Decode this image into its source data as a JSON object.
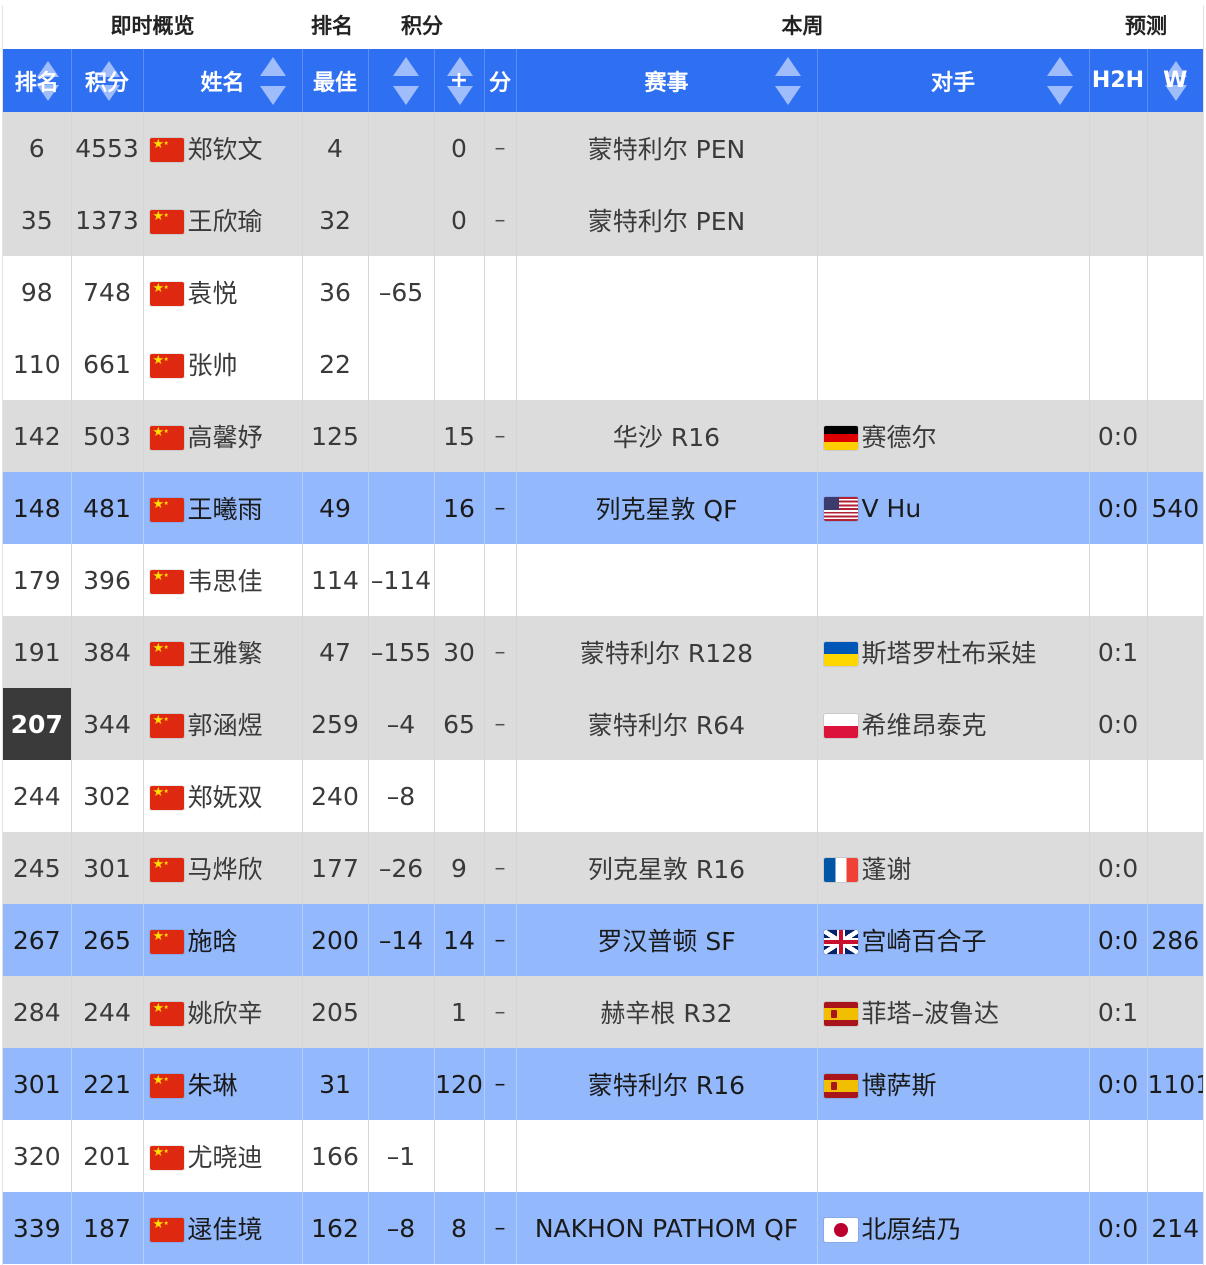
{
  "group_headers": {
    "live_overview": "即时概览",
    "rank": "排名",
    "points": "积分",
    "this_week": "本周",
    "prediction": "预测"
  },
  "columns": {
    "rank": "排名",
    "points": "积分",
    "name": "姓名",
    "best": "最佳",
    "change": "",
    "plus": "+",
    "points_suffix": "分",
    "event": "赛事",
    "opponent": "对手",
    "h2h": "H2H",
    "w": "W"
  },
  "rows": [
    {
      "rank": "6",
      "points": "4553",
      "flag": "cn",
      "name": "郑钦文",
      "best": "4",
      "change": "",
      "plus": "0",
      "dash": "–",
      "event": "蒙特利尔 PEN",
      "opp_flag": "",
      "opponent": "",
      "h2h": "",
      "w": "",
      "bg": "gray",
      "rank_highlight": false
    },
    {
      "rank": "35",
      "points": "1373",
      "flag": "cn",
      "name": "王欣瑜",
      "best": "32",
      "change": "",
      "plus": "0",
      "dash": "–",
      "event": "蒙特利尔 PEN",
      "opp_flag": "",
      "opponent": "",
      "h2h": "",
      "w": "",
      "bg": "gray",
      "rank_highlight": false
    },
    {
      "rank": "98",
      "points": "748",
      "flag": "cn",
      "name": "袁悦",
      "best": "36",
      "change": "–65",
      "plus": "",
      "dash": "",
      "event": "",
      "opp_flag": "",
      "opponent": "",
      "h2h": "",
      "w": "",
      "bg": "white",
      "rank_highlight": false
    },
    {
      "rank": "110",
      "points": "661",
      "flag": "cn",
      "name": "张帅",
      "best": "22",
      "change": "",
      "plus": "",
      "dash": "",
      "event": "",
      "opp_flag": "",
      "opponent": "",
      "h2h": "",
      "w": "",
      "bg": "white",
      "rank_highlight": false
    },
    {
      "rank": "142",
      "points": "503",
      "flag": "cn",
      "name": "高馨妤",
      "best": "125",
      "change": "",
      "plus": "15",
      "dash": "–",
      "event": "华沙 R16",
      "opp_flag": "de",
      "opponent": "赛德尔",
      "h2h": "0:0",
      "w": "",
      "bg": "gray",
      "rank_highlight": false
    },
    {
      "rank": "148",
      "points": "481",
      "flag": "cn",
      "name": "王曦雨",
      "best": "49",
      "change": "",
      "plus": "16",
      "dash": "–",
      "event": "列克星敦 QF",
      "opp_flag": "us",
      "opponent": "V Hu",
      "h2h": "0:0",
      "w": "540",
      "bg": "blue",
      "rank_highlight": false
    },
    {
      "rank": "179",
      "points": "396",
      "flag": "cn",
      "name": "韦思佳",
      "best": "114",
      "change": "–114",
      "plus": "",
      "dash": "",
      "event": "",
      "opp_flag": "",
      "opponent": "",
      "h2h": "",
      "w": "",
      "bg": "white",
      "rank_highlight": false
    },
    {
      "rank": "191",
      "points": "384",
      "flag": "cn",
      "name": "王雅繁",
      "best": "47",
      "change": "–155",
      "plus": "30",
      "dash": "–",
      "event": "蒙特利尔 R128",
      "opp_flag": "ua",
      "opponent": "斯塔罗杜布采娃",
      "h2h": "0:1",
      "w": "",
      "bg": "gray",
      "rank_highlight": false
    },
    {
      "rank": "207",
      "points": "344",
      "flag": "cn",
      "name": "郭涵煜",
      "best": "259",
      "change": "–4",
      "plus": "65",
      "dash": "–",
      "event": "蒙特利尔 R64",
      "opp_flag": "pl",
      "opponent": "希维昂泰克",
      "h2h": "0:0",
      "w": "",
      "bg": "gray",
      "rank_highlight": true
    },
    {
      "rank": "244",
      "points": "302",
      "flag": "cn",
      "name": "郑妩双",
      "best": "240",
      "change": "–8",
      "plus": "",
      "dash": "",
      "event": "",
      "opp_flag": "",
      "opponent": "",
      "h2h": "",
      "w": "",
      "bg": "white",
      "rank_highlight": false
    },
    {
      "rank": "245",
      "points": "301",
      "flag": "cn",
      "name": "马烨欣",
      "best": "177",
      "change": "–26",
      "plus": "9",
      "dash": "–",
      "event": "列克星敦 R16",
      "opp_flag": "fr",
      "opponent": "蓬谢",
      "h2h": "0:0",
      "w": "",
      "bg": "gray",
      "rank_highlight": false
    },
    {
      "rank": "267",
      "points": "265",
      "flag": "cn",
      "name": "施晗",
      "best": "200",
      "change": "–14",
      "plus": "14",
      "dash": "–",
      "event": "罗汉普顿 SF",
      "opp_flag": "gb",
      "opponent": "宫崎百合子",
      "h2h": "0:0",
      "w": "286",
      "bg": "blue",
      "rank_highlight": false
    },
    {
      "rank": "284",
      "points": "244",
      "flag": "cn",
      "name": "姚欣辛",
      "best": "205",
      "change": "",
      "plus": "1",
      "dash": "–",
      "event": "赫辛根 R32",
      "opp_flag": "es",
      "opponent": "菲塔–波鲁达",
      "h2h": "0:1",
      "w": "",
      "bg": "gray",
      "rank_highlight": false
    },
    {
      "rank": "301",
      "points": "221",
      "flag": "cn",
      "name": "朱琳",
      "best": "31",
      "change": "",
      "plus": "120",
      "dash": "–",
      "event": "蒙特利尔 R16",
      "opp_flag": "es",
      "opponent": "博萨斯",
      "h2h": "0:0",
      "w": "1101",
      "bg": "blue",
      "rank_highlight": false
    },
    {
      "rank": "320",
      "points": "201",
      "flag": "cn",
      "name": "尤晓迪",
      "best": "166",
      "change": "–1",
      "plus": "",
      "dash": "",
      "event": "",
      "opp_flag": "",
      "opponent": "",
      "h2h": "",
      "w": "",
      "bg": "white",
      "rank_highlight": false
    },
    {
      "rank": "339",
      "points": "187",
      "flag": "cn",
      "name": "逯佳境",
      "best": "162",
      "change": "–8",
      "plus": "8",
      "dash": "–",
      "event": "NAKHON PATHOM QF",
      "opp_flag": "jp",
      "opponent": "北原结乃",
      "h2h": "0:0",
      "w": "214",
      "bg": "blue",
      "rank_highlight": false
    }
  ],
  "colors": {
    "header_blue": "#2f6ff1",
    "row_gray": "#dcdcdc",
    "row_blue": "#93b8fb",
    "rank_highlight": "#3a3a3a"
  }
}
